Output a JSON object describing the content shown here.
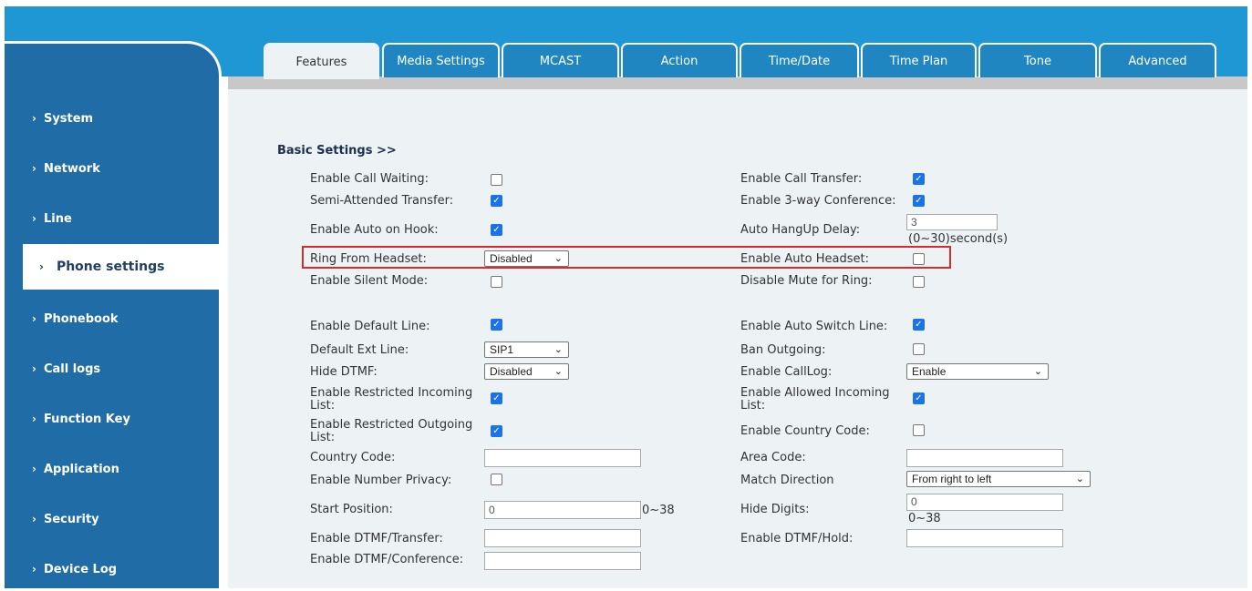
{
  "tabs": [
    "Features",
    "Media Settings",
    "MCAST",
    "Action",
    "Time/Date",
    "Time Plan",
    "Tone",
    "Advanced"
  ],
  "active_tab": "Features",
  "sidebar": {
    "items": [
      {
        "label": "System"
      },
      {
        "label": "Network"
      },
      {
        "label": "Line"
      },
      {
        "label": "Phone settings"
      },
      {
        "label": "Phonebook"
      },
      {
        "label": "Call logs"
      },
      {
        "label": "Function Key"
      },
      {
        "label": "Application"
      },
      {
        "label": "Security"
      },
      {
        "label": "Device Log"
      }
    ],
    "active": "Phone settings"
  },
  "section": {
    "title": "Basic Settings >>"
  },
  "left": {
    "enable_call_waiting": {
      "label": "Enable Call Waiting:",
      "checked": false
    },
    "semi_attended_transfer": {
      "label": "Semi-Attended Transfer:",
      "checked": true
    },
    "enable_auto_on_hook": {
      "label": "Enable Auto on Hook:",
      "checked": true
    },
    "ring_from_headset": {
      "label": "Ring From Headset:",
      "value": "Disabled"
    },
    "enable_silent_mode": {
      "label": "Enable Silent Mode:",
      "checked": false
    },
    "enable_default_line": {
      "label": "Enable Default Line:",
      "checked": true
    },
    "default_ext_line": {
      "label": "Default Ext Line:",
      "value": "SIP1"
    },
    "hide_dtmf": {
      "label": "Hide DTMF:",
      "value": "Disabled"
    },
    "restricted_incoming": {
      "label_line1": "Enable Restricted Incoming",
      "label_line2": "List:",
      "checked": true
    },
    "restricted_outgoing": {
      "label_line1": "Enable Restricted Outgoing",
      "label_line2": "List:",
      "checked": true
    },
    "country_code": {
      "label": "Country Code:",
      "value": ""
    },
    "number_privacy": {
      "label": "Enable Number Privacy:",
      "checked": false
    },
    "start_position": {
      "label": "Start Position:",
      "value": "0",
      "hint": "0~38"
    },
    "dtmf_transfer": {
      "label": "Enable DTMF/Transfer:",
      "value": ""
    },
    "dtmf_conference": {
      "label": "Enable DTMF/Conference:",
      "value": ""
    }
  },
  "right": {
    "enable_call_transfer": {
      "label": "Enable Call Transfer:",
      "checked": true
    },
    "three_way_conference": {
      "label": "Enable 3-way Conference:",
      "checked": true
    },
    "auto_hangup_delay": {
      "label": "Auto HangUp Delay:",
      "value": "3",
      "hint": "(0~30)second(s)"
    },
    "enable_auto_headset": {
      "label": "Enable Auto Headset:",
      "checked": false
    },
    "disable_mute_for_ring": {
      "label": "Disable Mute for Ring:",
      "checked": false
    },
    "auto_switch_line": {
      "label": "Enable Auto Switch Line:",
      "checked": true
    },
    "ban_outgoing": {
      "label": "Ban Outgoing:",
      "checked": false
    },
    "enable_calllog": {
      "label": "Enable CallLog:",
      "value": "Enable"
    },
    "allowed_incoming": {
      "label_line1": "Enable Allowed Incoming",
      "label_line2": "List:",
      "checked": true
    },
    "country_code_enable": {
      "label": "Enable Country Code:",
      "checked": false
    },
    "area_code": {
      "label": "Area Code:",
      "value": ""
    },
    "match_direction": {
      "label": "Match Direction",
      "value": "From right to left"
    },
    "hide_digits": {
      "label": "Hide Digits:",
      "value": "0",
      "hint": "0~38"
    },
    "dtmf_hold": {
      "label": "Enable DTMF/Hold:",
      "value": ""
    }
  },
  "colors": {
    "header": "#1f97d4",
    "sidebar": "#1f6ca6",
    "tab": "#1f86c2",
    "content_bg": "#edf3f5",
    "highlight": "#d92b2b",
    "checkbox": "#1a73e8"
  }
}
